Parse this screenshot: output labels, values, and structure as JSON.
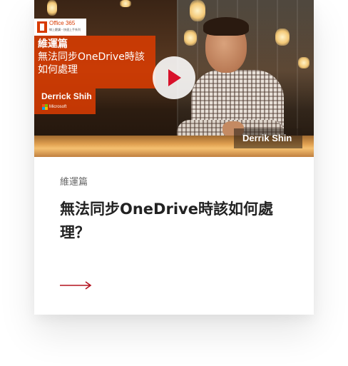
{
  "thumbnail": {
    "office_brand": "Office 365",
    "office_tagline": "線上聽講・快速上手系列",
    "title_lines": [
      "維運篇",
      "無法同步OneDrive時該",
      "如何處理"
    ],
    "author": "Derrick Shih",
    "microsoft_label": "Microsoft",
    "name_tag": "Derrik Shin",
    "play_icon": "play-icon"
  },
  "card": {
    "category": "維運篇",
    "headline": "無法同步OneDrive時該如何處理？",
    "arrow_icon": "arrow-right-icon"
  },
  "colors": {
    "accent": "#d83b01",
    "play": "#d8112a",
    "arrow": "#b3121f",
    "headline": "#222222",
    "category": "#666666"
  }
}
